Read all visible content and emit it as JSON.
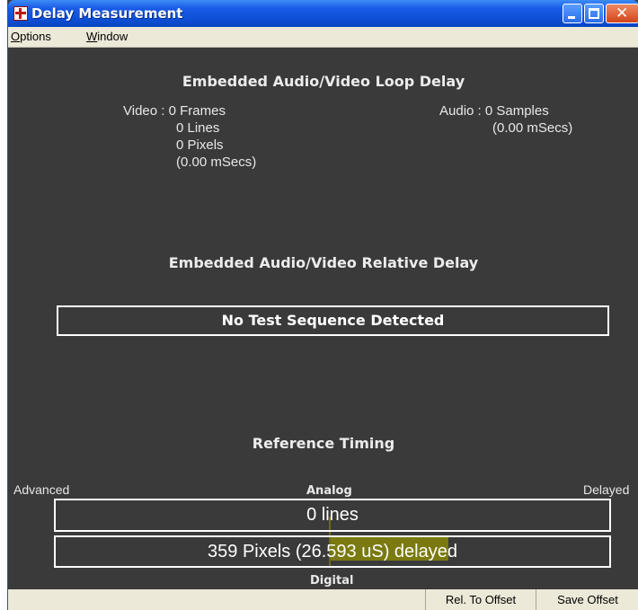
{
  "window": {
    "title": "Delay Measurement",
    "icon": "app-icon"
  },
  "menu": {
    "options": "Options",
    "window": "Window"
  },
  "loop_delay": {
    "heading": "Embedded Audio/Video Loop Delay",
    "video_frames": "Video : 0 Frames",
    "video_lines": "0 Lines",
    "video_pixels": "0 Pixels",
    "video_msecs": "(0.00 mSecs)",
    "audio_samples": "Audio : 0 Samples",
    "audio_msecs": "(0.00 mSecs)"
  },
  "relative_delay": {
    "heading": "Embedded Audio/Video Relative Delay",
    "status": "No Test Sequence Detected"
  },
  "reference_timing": {
    "heading": "Reference Timing",
    "advanced": "Advanced",
    "analog": "Analog",
    "delayed": "Delayed",
    "analog_value": "0 lines",
    "digital_value": "359 Pixels (26.593 uS) delayed",
    "digital": "Digital"
  },
  "status_bar": {
    "rel_offset": "Rel. To Offset",
    "save_offset": "Save Offset"
  },
  "colors": {
    "background": "#3a3a3a",
    "titlebar": "#0d4fd6",
    "highlight": "#7a7a10"
  }
}
